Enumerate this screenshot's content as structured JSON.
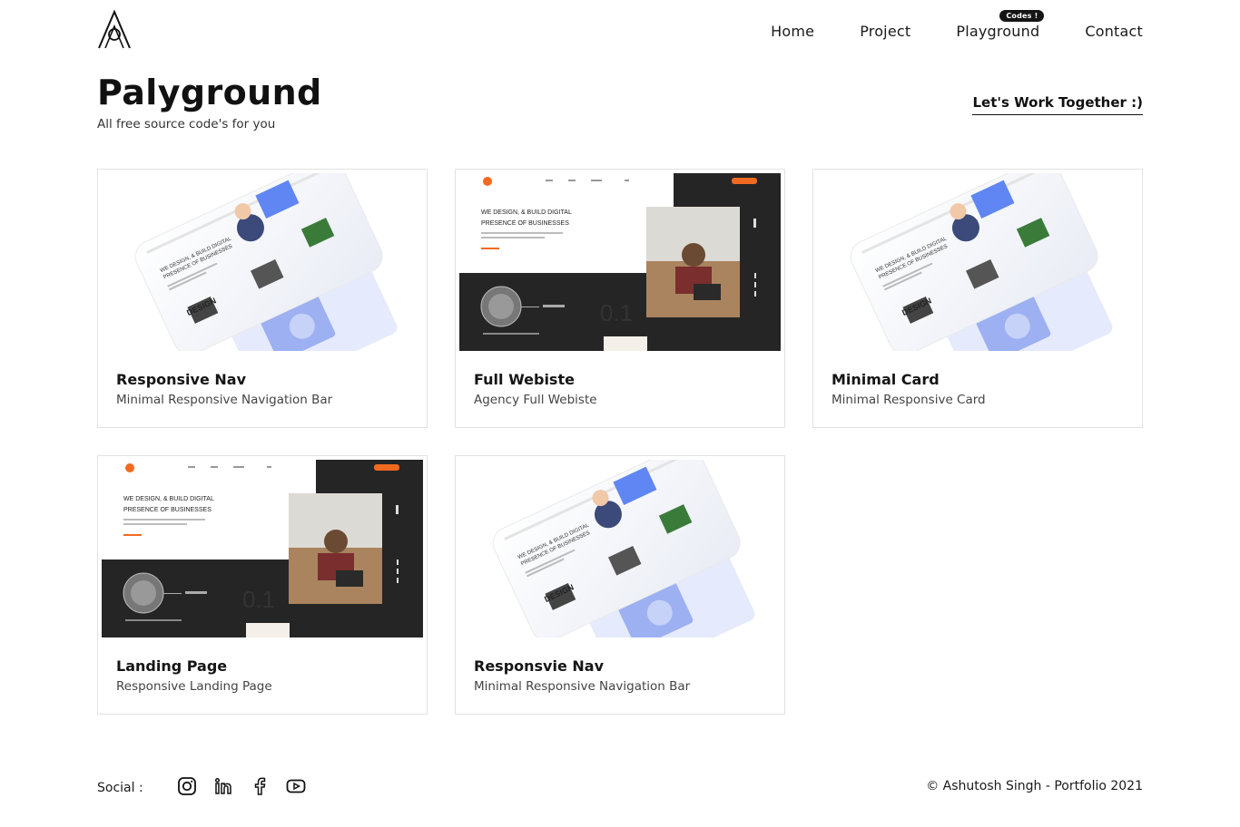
{
  "nav": {
    "items": [
      {
        "label": "Home"
      },
      {
        "label": "Project"
      },
      {
        "label": "Playground",
        "badge": "Codes !"
      },
      {
        "label": "Contact"
      }
    ]
  },
  "page": {
    "title": "Palyground",
    "subtitle": "All free source code's for you",
    "cta": "Let's Work Together :)"
  },
  "cards": [
    {
      "title": "Responsive Nav",
      "desc": "Minimal Responsive Navigation Bar",
      "thumb": "tilted-mockup"
    },
    {
      "title": "Full Webiste",
      "desc": "Agency Full Webiste",
      "thumb": "agency-site"
    },
    {
      "title": "Minimal Card",
      "desc": "Minimal Responsive Card",
      "thumb": "tilted-mockup"
    },
    {
      "title": "Landing Page",
      "desc": "Responsive Landing Page",
      "thumb": "agency-site"
    },
    {
      "title": "Responsvie Nav",
      "desc": "Minimal Responsive Navigation Bar",
      "thumb": "tilted-mockup"
    }
  ],
  "thumb_text": {
    "headline_1": "WE DESIGN, & BUILD DIGITAL",
    "headline_2": "PRESENCE OF BUSINESSES",
    "design_word": "DESIGN"
  },
  "footer": {
    "social_label": "Social :",
    "icons": [
      "instagram-icon",
      "linkedin-icon",
      "facebook-icon",
      "youtube-icon"
    ],
    "copyright": "© Ashutosh Singh - Portfolio 2021"
  },
  "colors": {
    "accent": "#f26a21",
    "dark": "#252525",
    "text": "#1a1a1a"
  }
}
